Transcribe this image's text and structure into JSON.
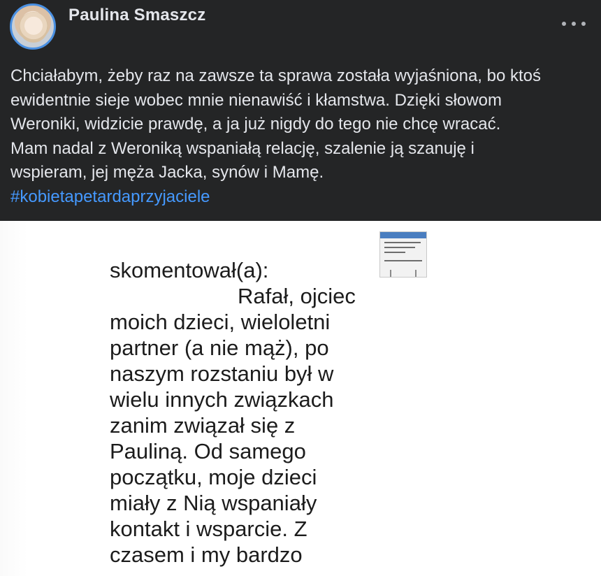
{
  "post": {
    "author": "Paulina Smaszcz",
    "avatar_icon": "profile-photo",
    "more_icon": "more-options-icon",
    "text_lines": [
      "Chciałabym, żeby raz na zawsze ta sprawa została wyjaśniona, bo ktoś",
      "ewidentnie sieje wobec mnie nienawiść i kłamstwa. Dzięki słowom",
      "Weroniki, widzicie prawdę, a ja już nigdy do tego nie chcę wracać.",
      "Mam nadal z Weroniką wspaniałą relację, szalenie ją szanuję i",
      "wspieram, jej męża Jacka, synów i Mamę."
    ],
    "hashtag": "#kobietapetardaprzyjaciele",
    "hashtag_color": "#4599ff"
  },
  "image": {
    "comment_lines": [
      "skomentował(a):",
      "Rafał, ojciec",
      "moich dzieci, wieloletni",
      "partner (a nie mąż), po",
      "naszym rozstaniu był w",
      "wielu innych związkach",
      "zanim związał się z",
      "Pauliną. Od samego",
      "początku, moje dzieci",
      "miały z Nią wspaniały",
      "kontakt i wsparcie. Z",
      "czasem i my bardzo"
    ]
  }
}
